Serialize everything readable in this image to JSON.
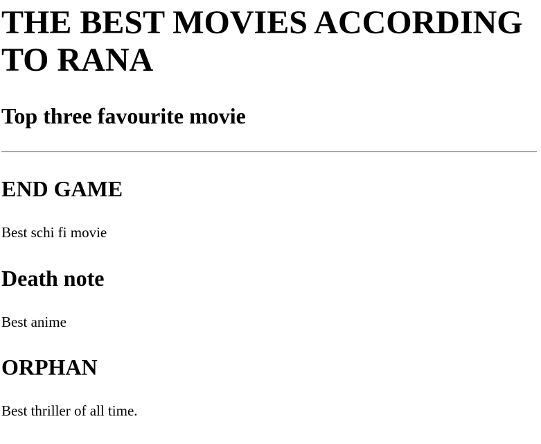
{
  "page": {
    "title": "THE BEST MOVIES ACCORDING TO RANA",
    "subtitle": "Top three favourite movie"
  },
  "movies": [
    {
      "title": "END GAME",
      "description": "Best schi fi movie"
    },
    {
      "title": "Death note",
      "description": "Best anime"
    },
    {
      "title": "ORPHAN",
      "description": "Best thriller of all time."
    }
  ]
}
